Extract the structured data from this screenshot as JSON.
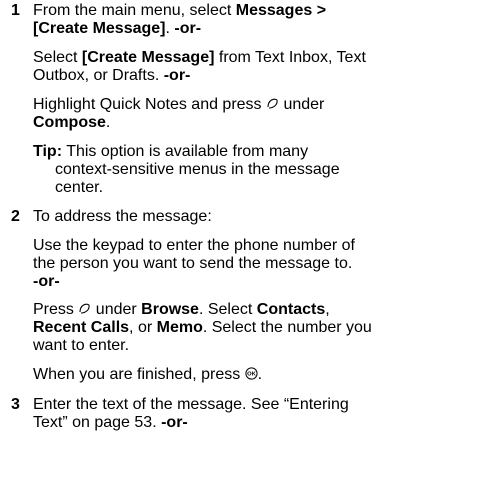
{
  "steps": [
    {
      "number": "1",
      "line1_pre": "From the main menu, select ",
      "line1_bold": "Messages >",
      "line2_bold": "[Create Message]",
      "line2_sep": ". ",
      "line2_or": "-or-",
      "alt1_pre": "",
      "alt1_bold": "[Create Message]",
      "alt1_rest": " from Text Inbox, Text",
      "alt1_line2": "Outbox, or Drafts. ",
      "alt1_or": "-or-",
      "alt1_select": "Select ",
      "alt2_line1": "Highlight Quick Notes and press ",
      "alt2_line1_post": " under",
      "alt2_bold": "Compose",
      "alt2_end": ".",
      "tip_label": "Tip:",
      "tip_line1": " This option is available from many",
      "tip_line2": "context-sensitive menus in the message",
      "tip_line3": "center."
    },
    {
      "number": "2",
      "intro": "To address the message:",
      "keypad_line1": "Use the keypad to enter the phone number of",
      "keypad_line2": "the person you want to send the message to.",
      "keypad_or": "-or-",
      "press": "Press ",
      "under": " under ",
      "browse": "Browse",
      "select_text": ". Select ",
      "contacts": "Contacts",
      "comma": ",",
      "recent_calls": "Recent Calls",
      "or_word": ", or ",
      "memo": "Memo",
      "after_memo": ". Select the number you",
      "want_line": "want to enter.",
      "finished": "When you are finished, press ",
      "finished_end": "."
    },
    {
      "number": "3",
      "line1": "Enter the text of the message. See “Entering",
      "line2_pre": "Text” on page 53. ",
      "line2_or": "-or-"
    }
  ],
  "icons": {
    "softkey": "right-softkey-icon",
    "ok": "ok-button-icon"
  }
}
